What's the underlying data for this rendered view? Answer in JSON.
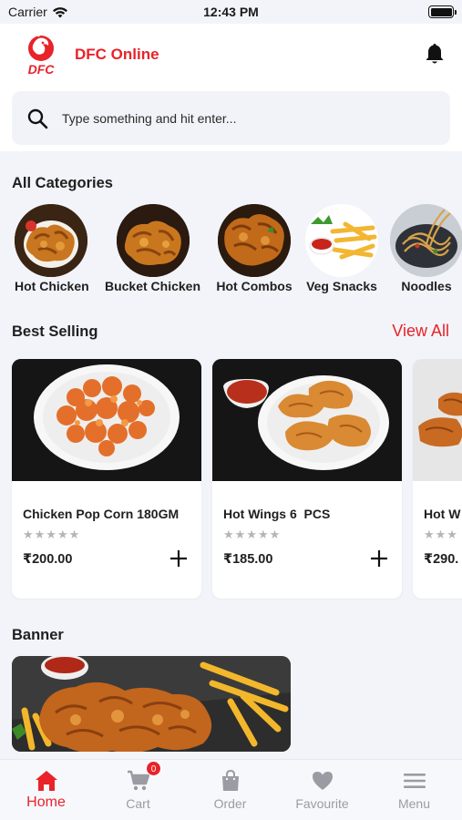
{
  "status_bar": {
    "carrier": "Carrier",
    "time": "12:43 PM"
  },
  "header": {
    "logo_text": "DFC",
    "app_title": "DFC Online",
    "notification_icon": "bell-icon"
  },
  "search": {
    "placeholder": "Type something and hit enter..."
  },
  "categories": {
    "title": "All Categories",
    "items": [
      {
        "label": "Hot Chicken"
      },
      {
        "label": "Bucket Chicken"
      },
      {
        "label": "Hot Combos"
      },
      {
        "label": "Veg Snacks"
      },
      {
        "label": "Noodles"
      }
    ]
  },
  "best_selling": {
    "title": "Best Selling",
    "view_all": "View All",
    "products": [
      {
        "name": "Chicken Pop Corn 180GM",
        "rating": "★★★★★",
        "price": "₹200.00"
      },
      {
        "name": "Hot Wings 6  PCS",
        "rating": "★★★★★",
        "price": "₹185.00"
      },
      {
        "name": "Hot W",
        "rating": "★★★",
        "price": "₹290."
      }
    ]
  },
  "banner": {
    "title": "Banner"
  },
  "tabbar": {
    "cart_badge": "0",
    "tabs": [
      {
        "label": "Home",
        "icon": "home-icon"
      },
      {
        "label": "Cart",
        "icon": "cart-icon"
      },
      {
        "label": "Order",
        "icon": "bag-icon"
      },
      {
        "label": "Favourite",
        "icon": "heart-icon"
      },
      {
        "label": "Menu",
        "icon": "hamburger-icon"
      }
    ]
  },
  "colors": {
    "accent": "#e8232a",
    "background": "#f2f4f9",
    "inactive": "#9a9ca3"
  }
}
